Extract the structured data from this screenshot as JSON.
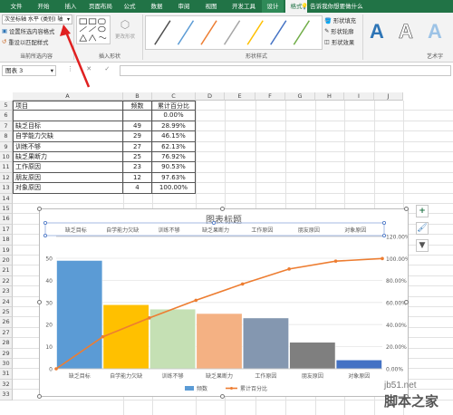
{
  "tabs": [
    "文件",
    "开始",
    "插入",
    "页面布局",
    "公式",
    "数据",
    "审阅",
    "视图",
    "开发工具",
    "设计",
    "格式"
  ],
  "tellme": "告诉我你想要做什么",
  "ribbon": {
    "selection_combo": "次坐标轴 水平 (类别) 轴",
    "format_selection": "设置所选内容格式",
    "reset_style": "重设以匹配样式",
    "group_current": "当前所选内容",
    "group_insert_shapes": "插入形状",
    "change_shape": "更改形状",
    "group_shape_styles": "形状样式",
    "shape_fill": "形状填充",
    "shape_outline": "形状轮廓",
    "shape_effects": "形状效果",
    "group_wordart": "艺术字",
    "wordart_letter": "A",
    "style_colors": [
      "#4d4d4d",
      "#5b9bd5",
      "#ed7d31",
      "#a5a5a5",
      "#ffc000",
      "#4472c4",
      "#70ad47"
    ],
    "wordart_colors": [
      "#2e75b6",
      "#ffffff",
      "#9dc3e6"
    ]
  },
  "name_box": "图表 3",
  "fx_icons": "⋮ ✕ ✓ fx",
  "columns": [
    "A",
    "B",
    "C",
    "D",
    "E",
    "F",
    "G",
    "H",
    "I",
    "J"
  ],
  "rows": [
    "5",
    "6",
    "7",
    "8",
    "9",
    "10",
    "11",
    "12",
    "13",
    "14",
    "15",
    "16",
    "17",
    "18",
    "19",
    "20",
    "21",
    "22",
    "23",
    "24",
    "25",
    "26",
    "27",
    "28",
    "29",
    "30",
    "31",
    "32",
    "33"
  ],
  "table": {
    "headers": [
      "项目",
      "频数",
      "累计百分比"
    ],
    "rows": [
      [
        "",
        "",
        "0.00%"
      ],
      [
        "缺乏目标",
        "49",
        "28.99%"
      ],
      [
        "自学能力欠缺",
        "29",
        "46.15%"
      ],
      [
        "训练不够",
        "27",
        "62.13%"
      ],
      [
        "缺乏果断力",
        "25",
        "76.92%"
      ],
      [
        "工作原因",
        "23",
        "90.53%"
      ],
      [
        "朋友原因",
        "12",
        "97.63%"
      ],
      [
        "对象原因",
        "4",
        "100.00%"
      ]
    ]
  },
  "chart_data": {
    "type": "bar",
    "title": "图表标题",
    "categories": [
      "缺乏目标",
      "自学能力欠缺",
      "训练不够",
      "缺乏果断力",
      "工作原因",
      "朋友原因",
      "对象原因"
    ],
    "series": [
      {
        "name": "频数",
        "values": [
          49,
          29,
          27,
          25,
          23,
          12,
          4
        ],
        "colors": [
          "#5b9bd5",
          "#ffc000",
          "#c5e0b4",
          "#f4b183",
          "#8497b0",
          "#7f7f7f",
          "#4472c4"
        ]
      },
      {
        "name": "累计百分比",
        "type": "line",
        "x": [
          0,
          1,
          2,
          3,
          4,
          5,
          6,
          7
        ],
        "values": [
          0,
          28.99,
          46.15,
          62.13,
          76.92,
          90.53,
          97.63,
          100
        ],
        "color": "#ed7d31"
      }
    ],
    "y_left": {
      "ticks": [
        "0",
        "10",
        "20",
        "30",
        "40",
        "50"
      ],
      "ylim": [
        0,
        50
      ]
    },
    "y_right": {
      "ticks": [
        "0.00%",
        "20.00%",
        "40.00%",
        "60.00%",
        "80.00%",
        "100.00%",
        "120.00%"
      ],
      "ylim": [
        0,
        120
      ]
    },
    "legend": "bottom"
  },
  "watermark": {
    "site": "jb51.net",
    "name": "脚本之家"
  }
}
